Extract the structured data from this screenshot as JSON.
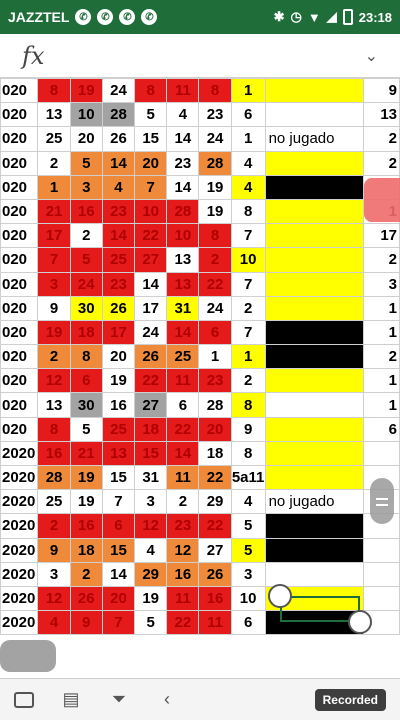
{
  "status": {
    "carrier": "JAZZTEL",
    "time": "23:18"
  },
  "formula": {
    "fx_label": "fx"
  },
  "toolbar": {
    "recorded_label": "Recorded"
  },
  "rows": [
    [
      [
        "020",
        "year"
      ],
      [
        "8",
        "red"
      ],
      [
        "19",
        "red"
      ],
      [
        "24",
        "wht"
      ],
      [
        "8",
        "red"
      ],
      [
        "11",
        "red"
      ],
      [
        "8",
        "red"
      ],
      [
        "1",
        "yel"
      ],
      [
        "",
        "yel"
      ],
      [
        "9",
        "wht"
      ]
    ],
    [
      [
        "020",
        "year"
      ],
      [
        "13",
        "wht"
      ],
      [
        "10",
        "gry"
      ],
      [
        "28",
        "gry"
      ],
      [
        "5",
        "wht"
      ],
      [
        "4",
        "wht"
      ],
      [
        "23",
        "wht"
      ],
      [
        "6",
        "wht"
      ],
      [
        "",
        "wht"
      ],
      [
        "13",
        "wht"
      ]
    ],
    [
      [
        "020",
        "year"
      ],
      [
        "25",
        "wht"
      ],
      [
        "20",
        "wht"
      ],
      [
        "26",
        "wht"
      ],
      [
        "15",
        "wht"
      ],
      [
        "14",
        "wht"
      ],
      [
        "24",
        "wht"
      ],
      [
        "1",
        "wht"
      ],
      [
        "no jugado",
        "wht"
      ],
      [
        "2",
        "wht"
      ]
    ],
    [
      [
        "020",
        "year"
      ],
      [
        "2",
        "wht"
      ],
      [
        "5",
        "org"
      ],
      [
        "14",
        "org"
      ],
      [
        "20",
        "org"
      ],
      [
        "23",
        "wht"
      ],
      [
        "28",
        "org"
      ],
      [
        "4",
        "wht"
      ],
      [
        "",
        "yel"
      ],
      [
        "2",
        "wht"
      ]
    ],
    [
      [
        "020",
        "year"
      ],
      [
        "1",
        "org"
      ],
      [
        "3",
        "org"
      ],
      [
        "4",
        "org"
      ],
      [
        "7",
        "org"
      ],
      [
        "14",
        "wht"
      ],
      [
        "19",
        "wht"
      ],
      [
        "4",
        "yel"
      ],
      [
        "",
        "blk"
      ],
      [
        "",
        "wht"
      ]
    ],
    [
      [
        "020",
        "year"
      ],
      [
        "21",
        "red"
      ],
      [
        "16",
        "red"
      ],
      [
        "23",
        "red"
      ],
      [
        "10",
        "red"
      ],
      [
        "28",
        "red"
      ],
      [
        "19",
        "wht"
      ],
      [
        "8",
        "wht"
      ],
      [
        "",
        "yel"
      ],
      [
        "1",
        "wht"
      ]
    ],
    [
      [
        "020",
        "year"
      ],
      [
        "17",
        "red"
      ],
      [
        "2",
        "wht"
      ],
      [
        "14",
        "red"
      ],
      [
        "22",
        "red"
      ],
      [
        "10",
        "red"
      ],
      [
        "8",
        "red"
      ],
      [
        "7",
        "wht"
      ],
      [
        "",
        "yel"
      ],
      [
        "17",
        "wht"
      ]
    ],
    [
      [
        "020",
        "year"
      ],
      [
        "7",
        "red"
      ],
      [
        "5",
        "red"
      ],
      [
        "25",
        "red"
      ],
      [
        "27",
        "red"
      ],
      [
        "13",
        "wht"
      ],
      [
        "2",
        "red"
      ],
      [
        "10",
        "yel"
      ],
      [
        "",
        "yel"
      ],
      [
        "2",
        "wht"
      ]
    ],
    [
      [
        "020",
        "year"
      ],
      [
        "3",
        "red"
      ],
      [
        "24",
        "red"
      ],
      [
        "23",
        "red"
      ],
      [
        "14",
        "wht"
      ],
      [
        "13",
        "red"
      ],
      [
        "22",
        "red"
      ],
      [
        "7",
        "wht"
      ],
      [
        "",
        "yel"
      ],
      [
        "3",
        "wht"
      ]
    ],
    [
      [
        "020",
        "year"
      ],
      [
        "9",
        "wht"
      ],
      [
        "30",
        "yel"
      ],
      [
        "26",
        "yel"
      ],
      [
        "17",
        "wht"
      ],
      [
        "31",
        "yel"
      ],
      [
        "24",
        "wht"
      ],
      [
        "2",
        "wht"
      ],
      [
        "",
        "yel"
      ],
      [
        "1",
        "wht"
      ]
    ],
    [
      [
        "020",
        "year"
      ],
      [
        "19",
        "red"
      ],
      [
        "18",
        "red"
      ],
      [
        "17",
        "red"
      ],
      [
        "24",
        "wht"
      ],
      [
        "14",
        "red"
      ],
      [
        "6",
        "red"
      ],
      [
        "7",
        "wht"
      ],
      [
        "",
        "blk"
      ],
      [
        "1",
        "wht"
      ]
    ],
    [
      [
        "020",
        "year"
      ],
      [
        "2",
        "org"
      ],
      [
        "8",
        "org"
      ],
      [
        "20",
        "wht"
      ],
      [
        "26",
        "org"
      ],
      [
        "25",
        "org"
      ],
      [
        "1",
        "wht"
      ],
      [
        "1",
        "yel"
      ],
      [
        "",
        "blk"
      ],
      [
        "2",
        "wht"
      ]
    ],
    [
      [
        "020",
        "year"
      ],
      [
        "12",
        "red"
      ],
      [
        "6",
        "red"
      ],
      [
        "19",
        "wht"
      ],
      [
        "22",
        "red"
      ],
      [
        "11",
        "red"
      ],
      [
        "23",
        "red"
      ],
      [
        "2",
        "wht"
      ],
      [
        "",
        "yel"
      ],
      [
        "1",
        "wht"
      ]
    ],
    [
      [
        "020",
        "year"
      ],
      [
        "13",
        "wht"
      ],
      [
        "30",
        "gry"
      ],
      [
        "16",
        "wht"
      ],
      [
        "27",
        "gry"
      ],
      [
        "6",
        "wht"
      ],
      [
        "28",
        "wht"
      ],
      [
        "8",
        "yel"
      ],
      [
        "",
        "wht"
      ],
      [
        "1",
        "wht"
      ]
    ],
    [
      [
        "020",
        "year"
      ],
      [
        "8",
        "red"
      ],
      [
        "5",
        "wht"
      ],
      [
        "25",
        "red"
      ],
      [
        "18",
        "red"
      ],
      [
        "22",
        "red"
      ],
      [
        "20",
        "red"
      ],
      [
        "9",
        "wht"
      ],
      [
        "",
        "yel"
      ],
      [
        "6",
        "wht"
      ]
    ],
    [
      [
        "2020",
        "year"
      ],
      [
        "16",
        "red"
      ],
      [
        "21",
        "red"
      ],
      [
        "13",
        "red"
      ],
      [
        "15",
        "red"
      ],
      [
        "14",
        "red"
      ],
      [
        "18",
        "wht"
      ],
      [
        "8",
        "wht"
      ],
      [
        "",
        "yel"
      ],
      [
        "",
        "wht"
      ]
    ],
    [
      [
        "2020",
        "year"
      ],
      [
        "28",
        "org"
      ],
      [
        "19",
        "org"
      ],
      [
        "15",
        "wht"
      ],
      [
        "31",
        "wht"
      ],
      [
        "11",
        "org"
      ],
      [
        "22",
        "org"
      ],
      [
        "5a11",
        "wht"
      ],
      [
        "",
        "yel"
      ],
      [
        "",
        "wht"
      ]
    ],
    [
      [
        "2020",
        "year"
      ],
      [
        "25",
        "wht"
      ],
      [
        "19",
        "wht"
      ],
      [
        "7",
        "wht"
      ],
      [
        "3",
        "wht"
      ],
      [
        "2",
        "wht"
      ],
      [
        "29",
        "wht"
      ],
      [
        "4",
        "wht"
      ],
      [
        "no jugado",
        "wht"
      ],
      [
        "",
        "wht"
      ]
    ],
    [
      [
        "2020",
        "year"
      ],
      [
        "2",
        "red"
      ],
      [
        "16",
        "red"
      ],
      [
        "6",
        "red"
      ],
      [
        "12",
        "red"
      ],
      [
        "23",
        "red"
      ],
      [
        "22",
        "red"
      ],
      [
        "5",
        "wht"
      ],
      [
        "",
        "blk"
      ],
      [
        "",
        "wht"
      ]
    ],
    [
      [
        "2020",
        "year"
      ],
      [
        "9",
        "org"
      ],
      [
        "18",
        "org"
      ],
      [
        "15",
        "org"
      ],
      [
        "4",
        "wht"
      ],
      [
        "12",
        "org"
      ],
      [
        "27",
        "wht"
      ],
      [
        "5",
        "yel"
      ],
      [
        "",
        "blk"
      ],
      [
        "",
        "wht"
      ]
    ],
    [
      [
        "2020",
        "year"
      ],
      [
        "3",
        "wht"
      ],
      [
        "2",
        "org"
      ],
      [
        "14",
        "wht"
      ],
      [
        "29",
        "org"
      ],
      [
        "16",
        "org"
      ],
      [
        "26",
        "org"
      ],
      [
        "3",
        "wht"
      ],
      [
        "",
        "wht"
      ],
      [
        "",
        "wht"
      ]
    ],
    [
      [
        "2020",
        "year"
      ],
      [
        "12",
        "red"
      ],
      [
        "26",
        "red"
      ],
      [
        "20",
        "red"
      ],
      [
        "19",
        "wht"
      ],
      [
        "11",
        "red"
      ],
      [
        "16",
        "red"
      ],
      [
        "10",
        "wht"
      ],
      [
        "",
        "yel"
      ],
      [
        "",
        "wht"
      ]
    ],
    [
      [
        "2020",
        "year"
      ],
      [
        "4",
        "red"
      ],
      [
        "9",
        "red"
      ],
      [
        "7",
        "red"
      ],
      [
        "5",
        "wht"
      ],
      [
        "22",
        "red"
      ],
      [
        "11",
        "red"
      ],
      [
        "6",
        "wht"
      ],
      [
        "",
        "blk"
      ],
      [
        "",
        "wht"
      ]
    ]
  ]
}
